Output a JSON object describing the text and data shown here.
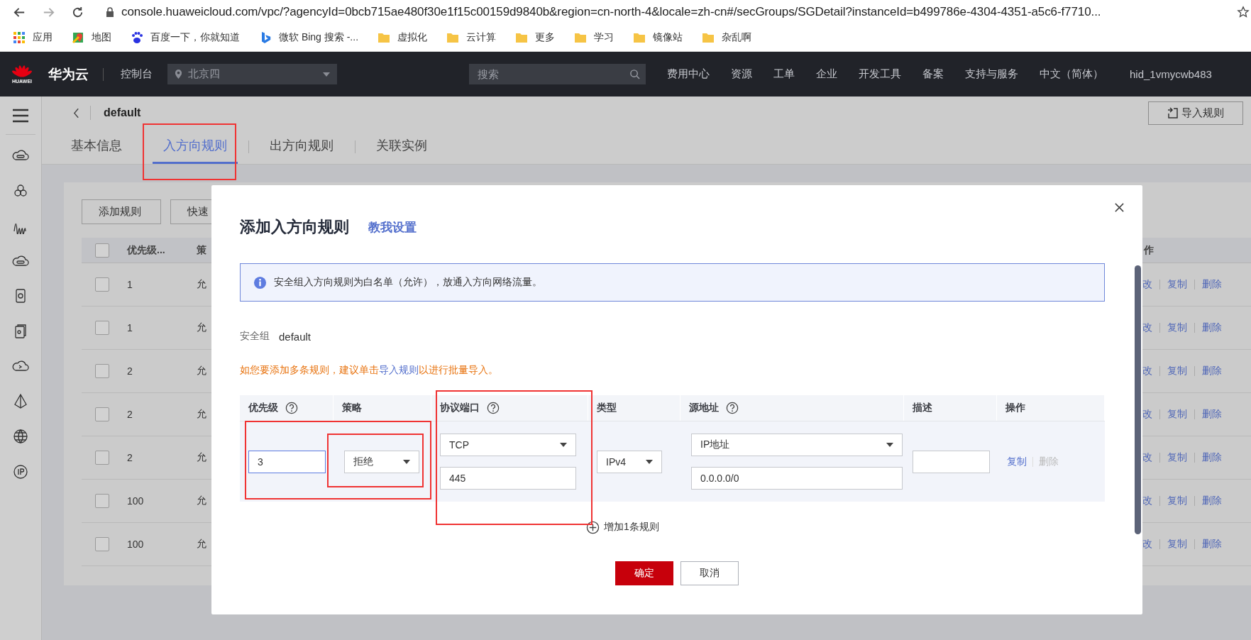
{
  "browser": {
    "url": "console.huaweicloud.com/vpc/?agencyId=0bcb715ae480f30e1f15c00159d9840b&region=cn-north-4&locale=zh-cn#/secGroups/SGDetail?instanceId=b499786e-4304-4351-a5c6-f7710...",
    "bookmarks": [
      {
        "label": "应用",
        "kind": "apps"
      },
      {
        "label": "地图",
        "kind": "maps"
      },
      {
        "label": "百度一下，你就知道",
        "kind": "paw"
      },
      {
        "label": "微软 Bing 搜索 -...",
        "kind": "bing"
      },
      {
        "label": "虚拟化",
        "kind": "folder"
      },
      {
        "label": "云计算",
        "kind": "folder"
      },
      {
        "label": "更多",
        "kind": "folder"
      },
      {
        "label": "学习",
        "kind": "folder"
      },
      {
        "label": "镜像站",
        "kind": "folder"
      },
      {
        "label": "杂乱啊",
        "kind": "folder"
      }
    ]
  },
  "header": {
    "logo_text": "HUAWEI",
    "brand": "华为云",
    "console": "控制台",
    "region": "北京四",
    "search_placeholder": "搜索",
    "nav": [
      "费用中心",
      "资源",
      "工单",
      "企业",
      "开发工具",
      "备案",
      "支持与服务",
      "中文（简体）"
    ],
    "user": "hid_1vmycwb483"
  },
  "page": {
    "title": "default",
    "import_button": "导入规则",
    "tabs": [
      {
        "label": "基本信息",
        "selected": false
      },
      {
        "label": "入方向规则",
        "selected": true
      },
      {
        "label": "出方向规则",
        "selected": false
      },
      {
        "label": "关联实例",
        "selected": false
      }
    ],
    "toolbar_buttons": [
      "添加规则",
      "快速"
    ],
    "table": {
      "select_all_checked": false,
      "columns": [
        "优先级...",
        "策"
      ],
      "action_header": "作",
      "rows": [
        {
          "checked": false,
          "priority": "1",
          "policy": "允",
          "actions": [
            "改",
            "复制",
            "删除"
          ]
        },
        {
          "checked": false,
          "priority": "1",
          "policy": "允",
          "actions": [
            "改",
            "复制",
            "删除"
          ]
        },
        {
          "checked": false,
          "priority": "2",
          "policy": "允",
          "actions": [
            "改",
            "复制",
            "删除"
          ]
        },
        {
          "checked": false,
          "priority": "2",
          "policy": "允",
          "actions": [
            "改",
            "复制",
            "删除"
          ]
        },
        {
          "checked": false,
          "priority": "2",
          "policy": "允",
          "actions": [
            "改",
            "复制",
            "删除"
          ]
        },
        {
          "checked": false,
          "priority": "100",
          "policy": "允",
          "actions": [
            "改",
            "复制",
            "删除"
          ]
        },
        {
          "checked": false,
          "priority": "100",
          "policy": "允",
          "actions": [
            "改",
            "复制",
            "删除"
          ]
        }
      ]
    }
  },
  "dialog": {
    "title": "添加入方向规则",
    "help_link": "教我设置",
    "notice": "安全组入方向规则为白名单（允许），放通入方向网络流量。",
    "group_label": "安全组",
    "group_value": "default",
    "hint_before": "如您要添加多条规则，建议单击",
    "hint_link": "导入规则",
    "hint_after": "以进行批量导入。",
    "columns": [
      {
        "label": "优先级",
        "help": true
      },
      {
        "label": "策略",
        "help": false
      },
      {
        "label": "协议端口",
        "help": true
      },
      {
        "label": "类型",
        "help": false
      },
      {
        "label": "源地址",
        "help": true
      },
      {
        "label": "描述",
        "help": false
      },
      {
        "label": "操作",
        "help": false
      }
    ],
    "rules": [
      {
        "priority": "3",
        "priority_focused": true,
        "policy": "拒绝",
        "protocol": "TCP",
        "port": "445",
        "type": "IPv4",
        "source_kind": "IP地址",
        "source": "0.0.0.0/0",
        "actions": [
          {
            "label": "复制",
            "disabled": false
          },
          {
            "label": "删除",
            "disabled": true
          }
        ]
      }
    ],
    "add_rule": "增加1条规则",
    "buttons": [
      {
        "label": "确定",
        "kind": "primary"
      },
      {
        "label": "取消",
        "kind": "secondary"
      }
    ]
  }
}
